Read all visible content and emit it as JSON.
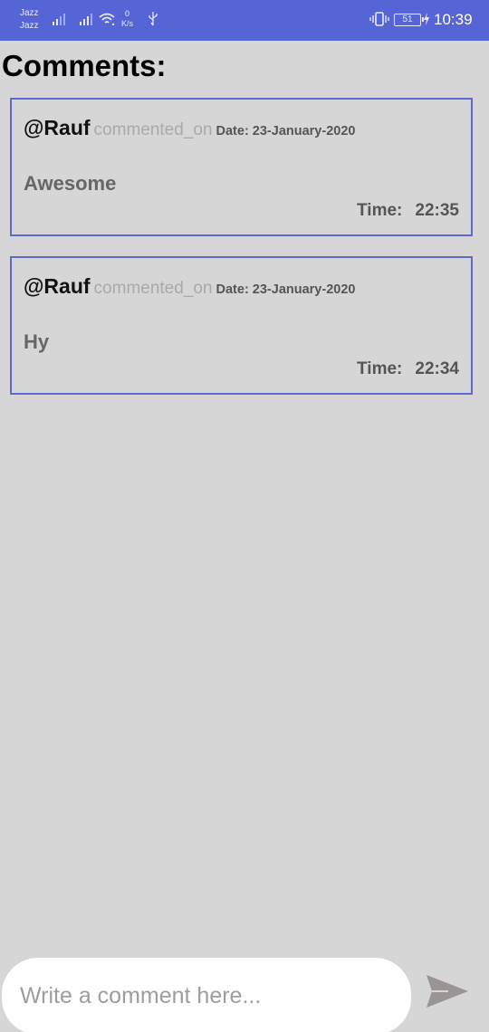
{
  "status_bar": {
    "carrier_1": "Jazz",
    "carrier_2": "Jazz",
    "net_speed_value": "0",
    "net_speed_unit": "K/s",
    "battery_level": "51",
    "time": "10:39"
  },
  "page": {
    "title": "Comments:"
  },
  "comments": [
    {
      "username": "@Rauf",
      "action": "commented_on",
      "date": "Date: 23-January-2020",
      "text": "Awesome",
      "time_label": "Time:",
      "time": "22:35"
    },
    {
      "username": "@Rauf",
      "action": "commented_on",
      "date": "Date: 23-January-2020",
      "text": "Hy",
      "time_label": "Time:",
      "time": "22:34"
    }
  ],
  "composer": {
    "placeholder": "Write a comment here...",
    "send_icon": "send-icon"
  },
  "colors": {
    "status_bar": "#5565d6",
    "card_border": "#5a6cd2",
    "background": "#d6d6d6"
  }
}
